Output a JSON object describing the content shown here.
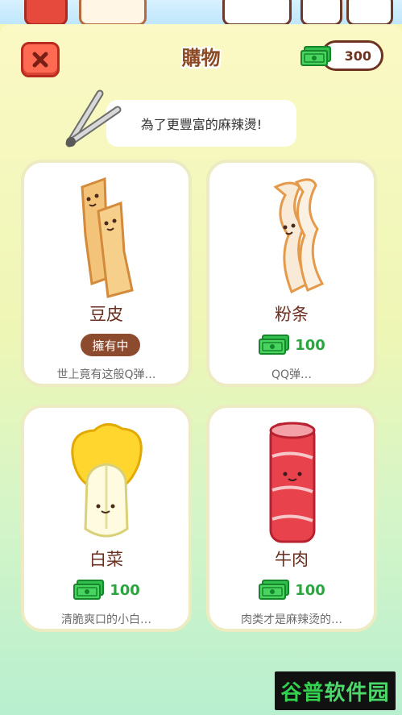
{
  "header": {
    "title": "購物",
    "currency_amount": "300"
  },
  "tip": {
    "text": "為了更豐富的麻辣燙!"
  },
  "items": [
    {
      "name": "豆皮",
      "status": "擁有中",
      "desc": "世上竟有这般Q弹…"
    },
    {
      "name": "粉条",
      "price": "100",
      "desc": "QQ弹…"
    },
    {
      "name": "白菜",
      "price": "100",
      "desc": "清脆爽口的小白…"
    },
    {
      "name": "牛肉",
      "price": "100",
      "desc": "肉类才是麻辣烫的…"
    }
  ],
  "watermark": {
    "part1": "谷普",
    "part2": "软件园"
  },
  "colors": {
    "accent_brown": "#8b4a24",
    "price_green": "#2aa640",
    "close_red": "#ff6a53"
  },
  "icons": {
    "close": "close-icon",
    "money": "money-icon",
    "tongs": "tongs-icon"
  }
}
